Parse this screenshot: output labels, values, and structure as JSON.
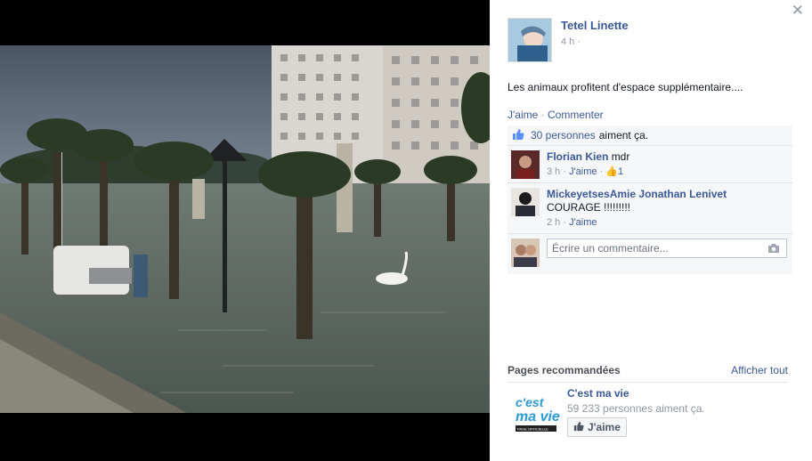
{
  "post": {
    "author": "Tetel Linette",
    "time": "4 h ·",
    "caption": "Les animaux profitent d'espace supplémentaire....",
    "actions": {
      "like": "J'aime",
      "separator": " · ",
      "comment": "Commenter"
    },
    "likes": {
      "count_link": "30 personnes",
      "rest": "aiment ça."
    }
  },
  "comments": [
    {
      "author": "Florian Kien",
      "text": "mdr",
      "time": "3 h",
      "like": "J'aime",
      "likes": "1"
    },
    {
      "author": "MickeyetsesAmie Jonathan Lenivet",
      "text": "COURAGE !!!!!!!!!",
      "time": "2 h",
      "like": "J'aime"
    }
  ],
  "compose": {
    "placeholder": "Écrire un commentaire..."
  },
  "recommended": {
    "title": "Pages recommandées",
    "see_all": "Afficher tout",
    "page": {
      "name": "C'est ma vie",
      "fans": "59 233 personnes aiment ça.",
      "button": "J'aime",
      "logo_text": "C'est ma vie",
      "logo_small": "PAGE OFFICIELLE"
    }
  },
  "icons": {
    "close": "close-icon",
    "thumb": "thumbs-up-icon",
    "camera": "camera-icon"
  },
  "colors": {
    "link": "#3b5998",
    "meta": "#9197a3",
    "ufi_bg": "#f6f7f9"
  }
}
